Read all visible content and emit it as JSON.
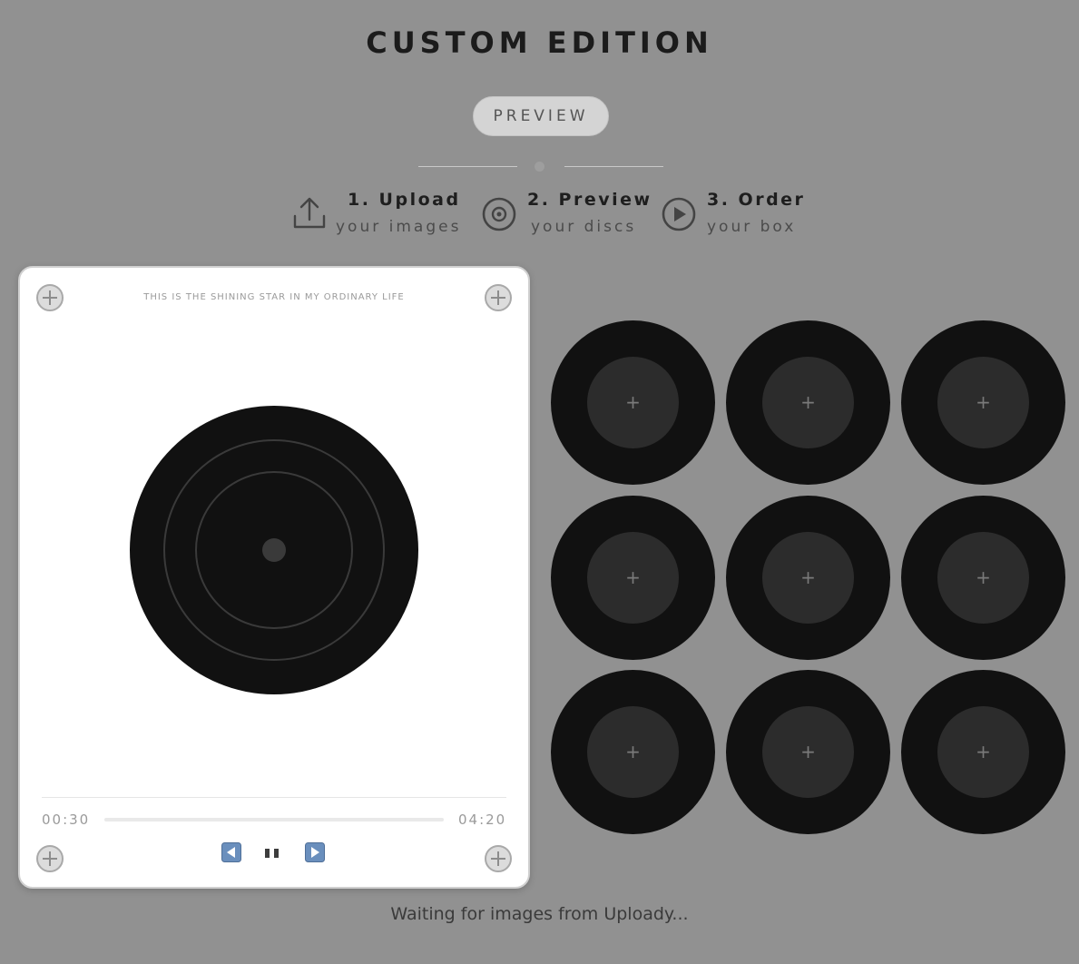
{
  "header": {
    "title": "CUSTOM EDITION",
    "preview_label": "PREVIEW"
  },
  "steps": [
    {
      "title": "1. Upload",
      "subtitle": "your images",
      "icon": "upload-icon"
    },
    {
      "title": "2. Preview",
      "subtitle": "your discs",
      "icon": "disc-target-icon"
    },
    {
      "title": "3. Order",
      "subtitle": "your box",
      "icon": "play-circle-icon"
    }
  ],
  "player": {
    "caption": "THIS IS THE SHINING STAR IN MY ORDINARY LIFE",
    "time_current": "00:30",
    "time_total": "04:20",
    "progress_fraction": 0.0
  },
  "discs": {
    "add_label": "+",
    "count": 9
  },
  "status": "Waiting for images from Uploady..."
}
